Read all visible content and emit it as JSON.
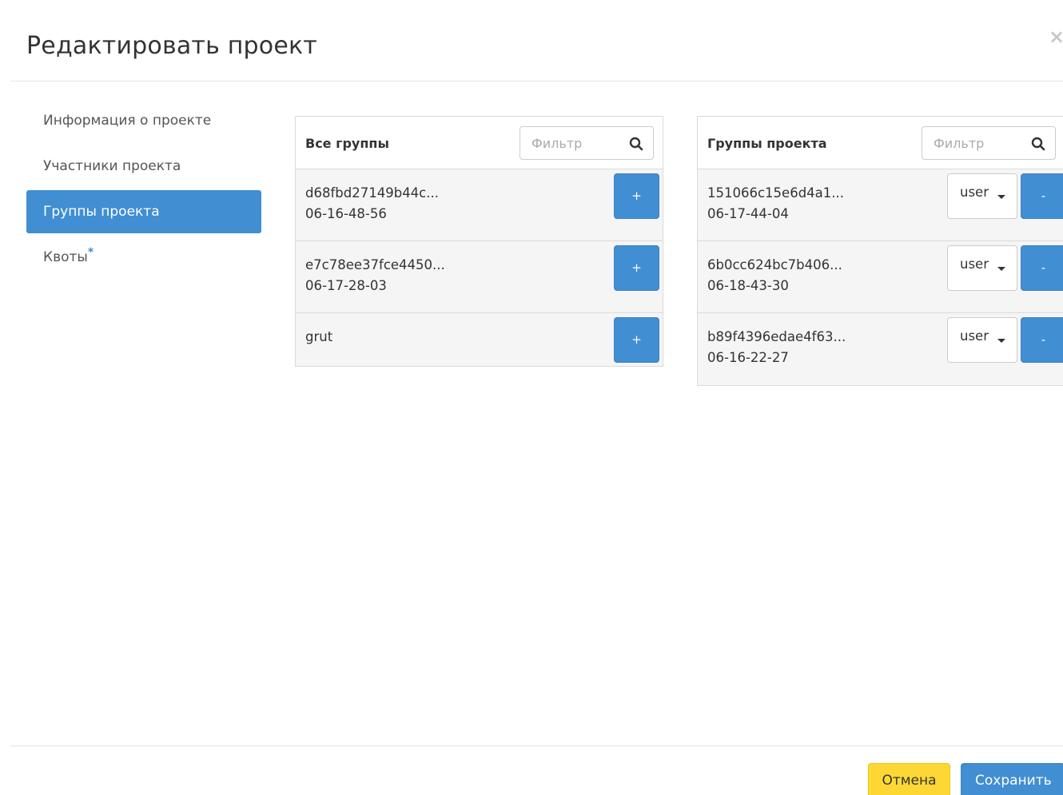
{
  "dialog": {
    "title": "Редактировать проект",
    "close_glyph": "×"
  },
  "nav": {
    "items": [
      {
        "label": "Информация о проекте",
        "active": false
      },
      {
        "label": "Участники проекта",
        "active": false
      },
      {
        "label": "Группы проекта",
        "active": true
      },
      {
        "label": "Квоты",
        "active": false,
        "required_mark": "*"
      }
    ]
  },
  "all_groups": {
    "title": "Все группы",
    "filter_placeholder": "Фильтр",
    "search_icon": "search-icon",
    "add_label": "+",
    "rows": [
      {
        "name": "d68fbd27149b44c...",
        "date": "06-16-48-56"
      },
      {
        "name": "e7c78ee37fce4450...",
        "date": "06-17-28-03"
      },
      {
        "name": "grut",
        "date": ""
      }
    ]
  },
  "project_groups": {
    "title": "Группы проекта",
    "filter_placeholder": "Фильтр",
    "search_icon": "search-icon",
    "remove_label": "-",
    "rows": [
      {
        "name": "151066c15e6d4a1...",
        "date": "06-17-44-04",
        "role": "user"
      },
      {
        "name": "6b0cc624bc7b406...",
        "date": "06-18-43-30",
        "role": "user"
      },
      {
        "name": "b89f4396edae4f63...",
        "date": "06-16-22-27",
        "role": "user"
      }
    ]
  },
  "footer": {
    "cancel_label": "Отмена",
    "save_label": "Сохранить"
  },
  "colors": {
    "accent": "#418ed3",
    "cancel": "#fdd835"
  }
}
